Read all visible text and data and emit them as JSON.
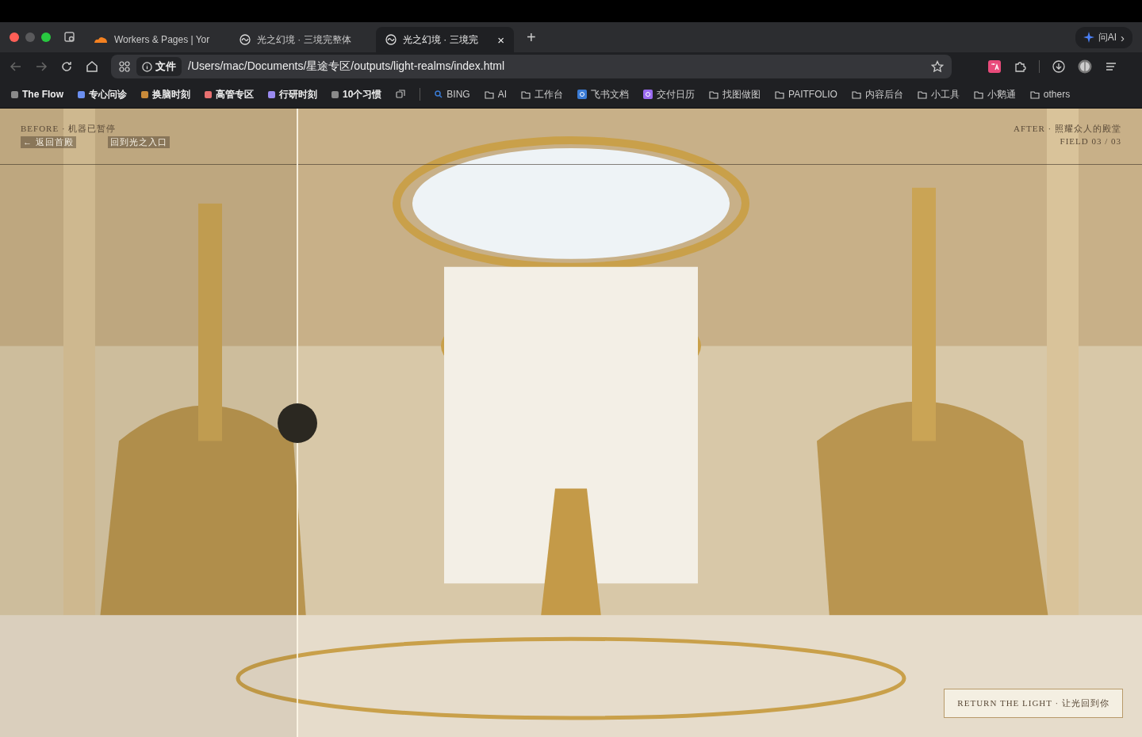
{
  "tabs": [
    {
      "title": "Workers & Pages | Yor",
      "kind": "cloud",
      "selected": false
    },
    {
      "title": "光之幻境 · 三境完整体",
      "kind": "swirl",
      "selected": false
    },
    {
      "title": "光之幻境 · 三境完",
      "kind": "swirl",
      "selected": true
    }
  ],
  "tab_close": "×",
  "new_tab": "+",
  "ai_button": "问AI",
  "ai_chevron": "›",
  "address": {
    "scheme": "文件",
    "url": "/Users/mac/Documents/星途专区/outputs/light-realms/index.html"
  },
  "bookmarks": [
    {
      "kind": "dot",
      "label": "The Flow",
      "color": "#8a8a8a"
    },
    {
      "kind": "dot",
      "label": "专心问诊",
      "color": "#6b8ff0"
    },
    {
      "kind": "dot",
      "label": "换脑时刻",
      "color": "#c88a3a"
    },
    {
      "kind": "dot",
      "label": "高管专区",
      "color": "#e87070"
    },
    {
      "kind": "dot",
      "label": "行研时刻",
      "color": "#9a8af0"
    },
    {
      "kind": "dot",
      "label": "10个习惯",
      "color": "#8a8a8a"
    },
    {
      "kind": "search",
      "label": "BING"
    },
    {
      "kind": "folder",
      "label": "AI"
    },
    {
      "kind": "folder",
      "label": "工作台"
    },
    {
      "kind": "app",
      "label": "飞书文档"
    },
    {
      "kind": "app",
      "label": "交付日历"
    },
    {
      "kind": "folder",
      "label": "找图做图"
    },
    {
      "kind": "folder",
      "label": "PAITFOLIO"
    },
    {
      "kind": "folder",
      "label": "内容后台"
    },
    {
      "kind": "folder",
      "label": "小工具"
    },
    {
      "kind": "folder",
      "label": "小鹅通"
    },
    {
      "kind": "folder",
      "label": "others"
    }
  ],
  "page": {
    "before_label": "BEFORE · 机器已暂停",
    "back_link": "← 返回首殿",
    "entry_link": "回到光之入口",
    "after_label": "AFTER · 照耀众人的殿堂",
    "field": "FIELD 03 / 03",
    "compare": {
      "level": 0.26
    },
    "cta": "RETURN THE LIGHT · 让光回到你"
  }
}
